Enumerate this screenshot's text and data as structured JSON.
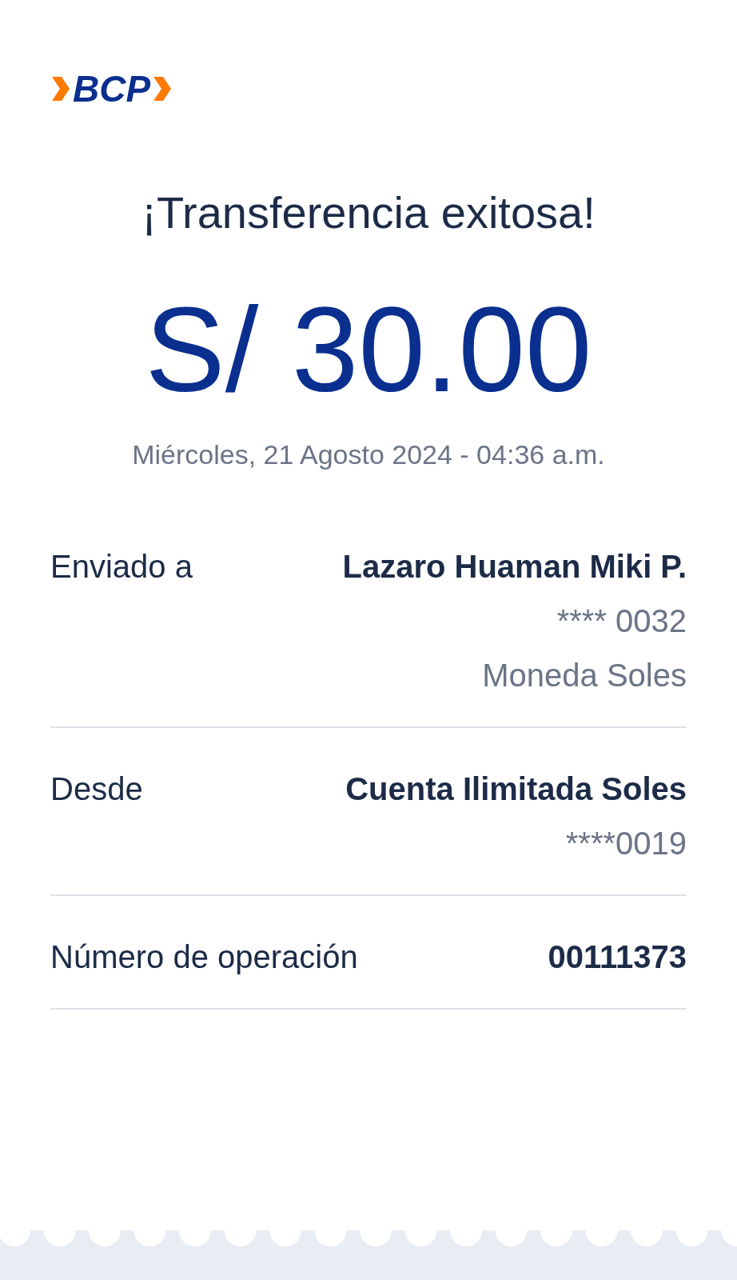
{
  "logo": {
    "text": "BCP"
  },
  "title": "¡Transferencia exitosa!",
  "amount": "S/ 30.00",
  "date": "Miércoles, 21 Agosto 2024 - 04:36 a.m.",
  "details": [
    {
      "label": "Enviado a",
      "values": [
        {
          "text": "Lazaro Huaman Miki P.",
          "kind": "strong"
        },
        {
          "text": "**** 0032",
          "kind": "muted"
        },
        {
          "text": "Moneda Soles",
          "kind": "muted"
        }
      ]
    },
    {
      "label": "Desde",
      "values": [
        {
          "text": "Cuenta Ilimitada Soles",
          "kind": "strong"
        },
        {
          "text": "****0019",
          "kind": "muted"
        }
      ]
    },
    {
      "label": "Número de operación",
      "values": [
        {
          "text": "00111373",
          "kind": "strong"
        }
      ]
    }
  ]
}
